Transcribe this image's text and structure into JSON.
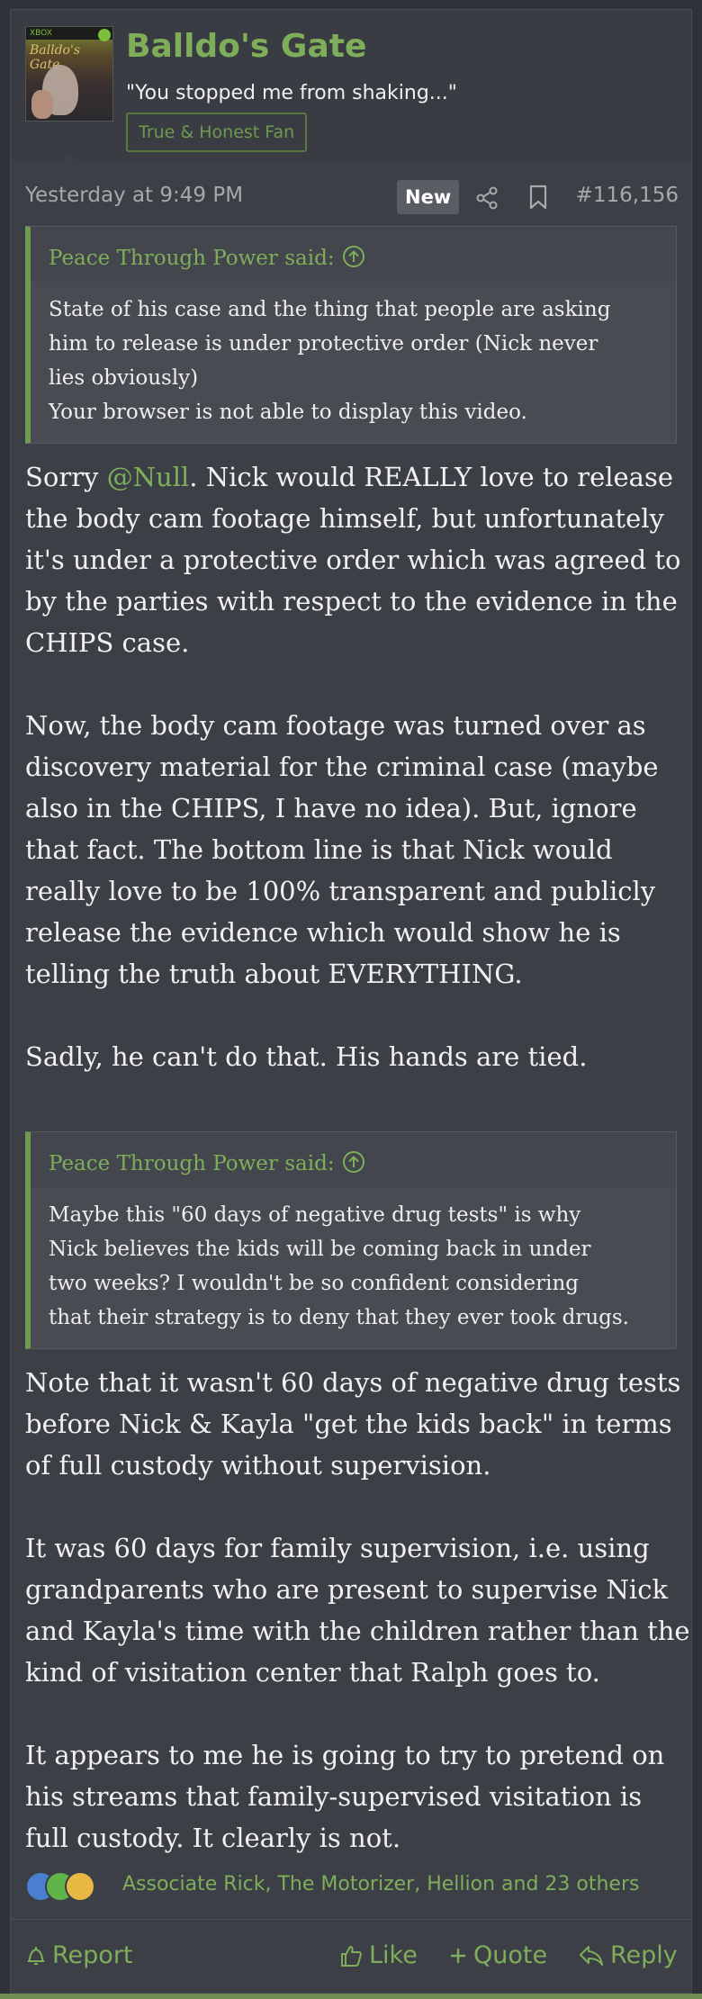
{
  "user": {
    "avatar_lettering": "Balldo's Gate",
    "avatar_brand": "XBOX",
    "username": "Balldo's Gate",
    "custom_title": "\"You stopped me from shaking...\"",
    "banner": "True & Honest Fan"
  },
  "meta": {
    "date": "Yesterday at 9:49 PM",
    "new_badge": "New",
    "post_number": "#116,156"
  },
  "quote1": {
    "author_line": "Peace Through Power said:",
    "lines": [
      "State of his case and the thing that people are asking",
      "him to release is under protective order (Nick never",
      "lies obviously)",
      "Your browser is not able to display this video."
    ]
  },
  "body1": {
    "prefix": "Sorry ",
    "mention": "@Null",
    "text": ". Nick would REALLY love to release the body cam footage himself, but unfortunately it's under a protective order which was agreed to by the parties with respect to the evidence in the CHIPS case."
  },
  "body2": "Now, the body cam footage was turned over as discovery material for the criminal case (maybe also in the CHIPS, I have no idea). But, ignore that fact. The bottom line is that Nick would really love to be 100% transparent and publicly release the evidence which would show he is telling the truth about EVERYTHING.",
  "body3": "Sadly, he can't do that. His hands are tied.",
  "quote2": {
    "author_line": "Peace Through Power said:",
    "lines": [
      "Maybe this \"60 days of negative drug tests\" is why",
      "Nick believes the kids will be coming back in under",
      "two weeks? I wouldn't be so confident considering",
      "that their strategy is to deny that they ever took drugs."
    ]
  },
  "body4": "Note that it wasn't 60 days of negative drug tests before Nick & Kayla \"get the kids back\" in terms of full custody without supervision.",
  "body5": "It was 60 days for family supervision, i.e. using grandparents who are present to supervise Nick and Kayla's time with the children rather than the kind of visitation center that Ralph goes to.",
  "body6": "It appears to me he is going to try to pretend on his streams that family-supervised visitation is full custody. It clearly is not.",
  "reactions": {
    "icons": [
      "like-reaction-icon",
      "check-reaction-icon",
      "thinking-reaction-icon"
    ],
    "names": "Associate Rick, The Motorizer, Hellion and 23 others"
  },
  "actions": {
    "report": "Report",
    "like": "Like",
    "quote": "Quote",
    "reply": "Reply"
  },
  "colors": {
    "accent_green": "#7fae5a",
    "background": "#3c3f46",
    "quote_bar": "#6f9a4f"
  }
}
